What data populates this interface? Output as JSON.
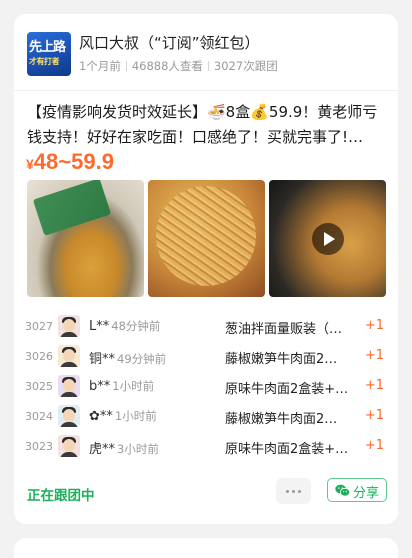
{
  "header": {
    "logo_text_1": "先上路",
    "logo_text_2": "才有打者",
    "name": "风口大叔（“订阅”领红包）",
    "time_ago": "1个月前",
    "views": "46888人查看",
    "follows": "3027次跟团"
  },
  "post": {
    "title": "【疫情影响发货时效延长】🍜8盒💰59.9！黄老师亏钱支持！好好在家吃面！口感绝了！买就完事了!…",
    "price_symbol": "¥",
    "price_range": "48~59.9"
  },
  "photos": [
    {
      "icon": "noodle-pack-photo"
    },
    {
      "icon": "noodle-bowl-photo"
    },
    {
      "icon": "noodle-video-photo",
      "has_play": true
    }
  ],
  "orders": [
    {
      "num": "3027",
      "user": "L**",
      "time": "48分钟前",
      "item": "葱油拌面量贩装（…",
      "plus": "+1",
      "avatar_bg": "#f4e1e1"
    },
    {
      "num": "3026",
      "user": "铜**",
      "time": "49分钟前",
      "item": "藤椒嫩笋牛肉面2…",
      "plus": "+1",
      "avatar_bg": "#f6ead2"
    },
    {
      "num": "3025",
      "user": "b**",
      "time": "1小时前",
      "item": "原味牛肉面2盒装+…",
      "plus": "+1",
      "avatar_bg": "#eadcf2"
    },
    {
      "num": "3024",
      "user": "✿**",
      "time": "1小时前",
      "item": "藤椒嫩笋牛肉面2…",
      "plus": "+1",
      "avatar_bg": "#e0eef3"
    },
    {
      "num": "3023",
      "user": "虎**",
      "time": "3小时前",
      "item": "原味牛肉面2盒装+…",
      "plus": "+1",
      "avatar_bg": "#f4e1e1"
    }
  ],
  "footer": {
    "following_label": "正在跟团中",
    "share_label": "分享"
  },
  "colors": {
    "accent_orange": "#ff6a2b",
    "accent_green": "#1db05a"
  }
}
